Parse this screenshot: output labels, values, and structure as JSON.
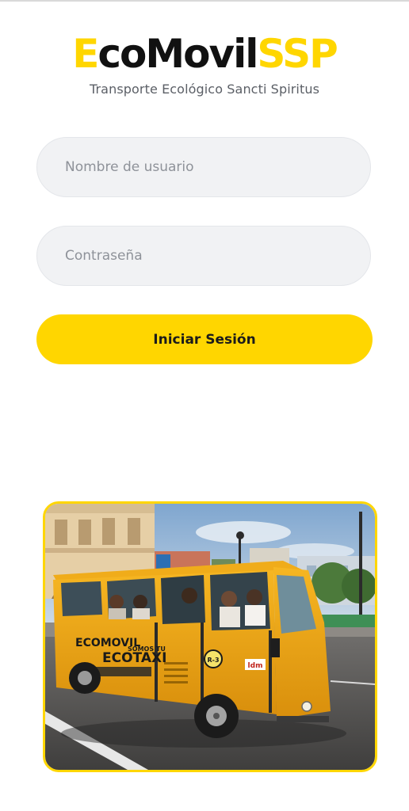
{
  "app": {
    "logo_segments": [
      {
        "text": "E",
        "color": "#FFD600"
      },
      {
        "text": "coMovil",
        "color": "#111111"
      },
      {
        "text": "SSP",
        "color": "#FFD600"
      }
    ],
    "tagline": "Transporte Ecológico Sancti Spiritus"
  },
  "login_form": {
    "username_placeholder": "Nombre de usuario",
    "username_value": "",
    "password_placeholder": "Contraseña",
    "password_value": "",
    "submit_label": "Iniciar Sesión"
  },
  "photo": {
    "vehicle_text_brand": "ECOMOVIL",
    "vehicle_text_slogan": "SOMOS TU",
    "vehicle_text_main": "ECOTAXI",
    "vehicle_route_badge": "R-3",
    "vehicle_plate_badge": "ldm"
  },
  "colors": {
    "accent": "#FFD600",
    "input_bg": "#F1F2F4",
    "text_dark": "#111111",
    "text_muted": "#5b5f66"
  }
}
